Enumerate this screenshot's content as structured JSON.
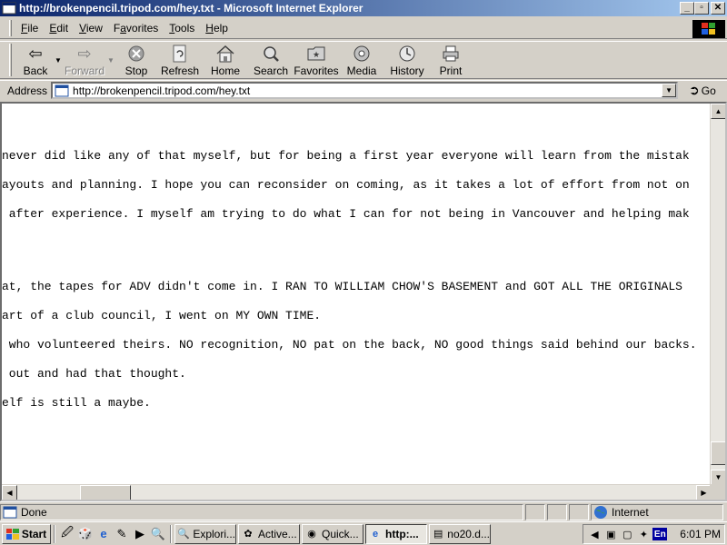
{
  "window": {
    "title": "http://brokenpencil.tripod.com/hey.txt - Microsoft Internet Explorer",
    "controls": {
      "minimize": "_",
      "maximize": "▫",
      "close": "✕"
    }
  },
  "menu": [
    "File",
    "Edit",
    "View",
    "Favorites",
    "Tools",
    "Help"
  ],
  "menu_access": [
    "F",
    "E",
    "V",
    "a",
    "T",
    "H"
  ],
  "toolbar": {
    "back": "Back",
    "forward": "Forward",
    "stop": "Stop",
    "refresh": "Refresh",
    "home": "Home",
    "search": "Search",
    "favorites": "Favorites",
    "media": "Media",
    "history": "History",
    "print": "Print"
  },
  "address": {
    "label": "Address",
    "url": "http://brokenpencil.tripod.com/hey.txt",
    "go": "Go"
  },
  "content": {
    "lines": [
      "never did like any of that myself, but for being a first year everyone will learn from the mistak",
      "ayouts and planning. I hope you can reconsider on coming, as it takes a lot of effort from not on",
      " after experience. I myself am trying to do what I can for not being in Vancouver and helping mak",
      "at, the tapes for ADV didn't come in. I RAN TO WILLIAM CHOW'S BASEMENT and GOT ALL THE ORIGINALS",
      "art of a club council, I went on MY OWN TIME.",
      " who volunteered theirs. NO recognition, NO pat on the back, NO good things said behind our backs.",
      " out and had that thought.",
      "elf is still a maybe."
    ]
  },
  "status": {
    "text": "Done",
    "zone": "Internet"
  },
  "taskbar": {
    "start": "Start",
    "tasks": [
      {
        "label": "Explori...",
        "icon": "search-icon"
      },
      {
        "label": "Active...",
        "icon": "activex-icon"
      },
      {
        "label": "Quick...",
        "icon": "quicktime-icon"
      },
      {
        "label": "http:...",
        "icon": "ie-icon",
        "active": true
      },
      {
        "label": "no20.d...",
        "icon": "document-icon"
      }
    ],
    "tray_lang": "En",
    "clock": "6:01 PM"
  },
  "colors": {
    "title_start": "#0a246a",
    "title_end": "#a6caf0",
    "chrome": "#d4d0c8"
  }
}
